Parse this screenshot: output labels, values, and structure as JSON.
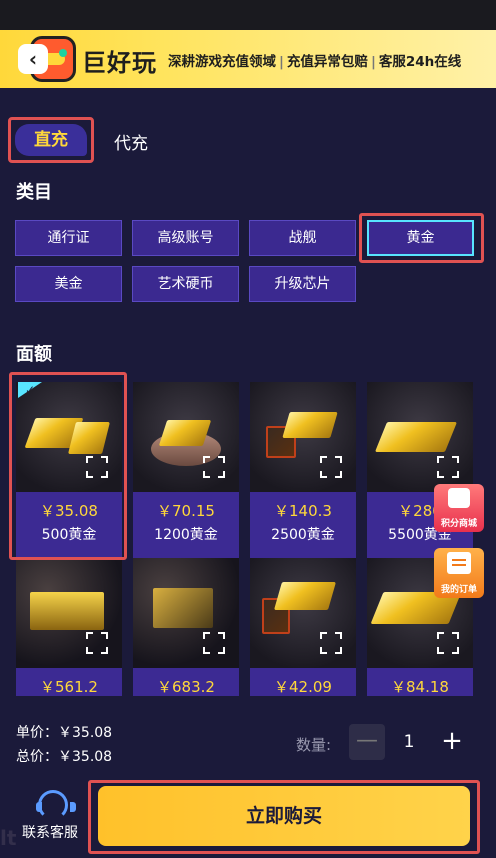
{
  "banner": {
    "logo_text": "巨好玩",
    "slogan_1": "深耕游戏充值领域",
    "slogan_2": "充值异常包赔",
    "slogan_3": "客服24h在线",
    "separator": "|",
    "back_icon": "chevron-left-icon"
  },
  "tabs": {
    "direct": "直充",
    "proxy": "代充"
  },
  "category": {
    "title": "类目",
    "items": [
      "通行证",
      "高级账号",
      "战舰",
      "黄金",
      "美金",
      "艺术硬币",
      "升级芯片"
    ],
    "selected": "黄金"
  },
  "denomination": {
    "title": "面额",
    "cards": [
      {
        "price": "￥35.08",
        "amount": "500黄金"
      },
      {
        "price": "￥70.15",
        "amount": "1200黄金"
      },
      {
        "price": "￥140.3",
        "amount": "2500黄金"
      },
      {
        "price": "￥280",
        "amount": "5500黄金"
      },
      {
        "price": "￥561.2",
        "amount": ""
      },
      {
        "price": "￥683.2",
        "amount": ""
      },
      {
        "price": "￥42.09",
        "amount": ""
      },
      {
        "price": "￥84.18",
        "amount": ""
      }
    ],
    "selected_index": 0,
    "check_mark": "✓"
  },
  "float": {
    "mall": "积分商城",
    "orders": "我的订单"
  },
  "summary": {
    "unit_price": "单价：￥35.08",
    "total_price": "总价：￥35.08",
    "quantity_label": "数量:",
    "quantity": "1",
    "minus": "—",
    "plus": "+"
  },
  "footer": {
    "service": "联系客服",
    "buy": "立即购买",
    "watermark": "lt"
  },
  "colors": {
    "background": "#1b1a3a",
    "accent_purple": "#3b2990",
    "price_yellow": "#ffd83a",
    "selection_cyan": "#58e5ff",
    "annotation_red": "#e05252",
    "buy_button": "#ffc12a"
  }
}
